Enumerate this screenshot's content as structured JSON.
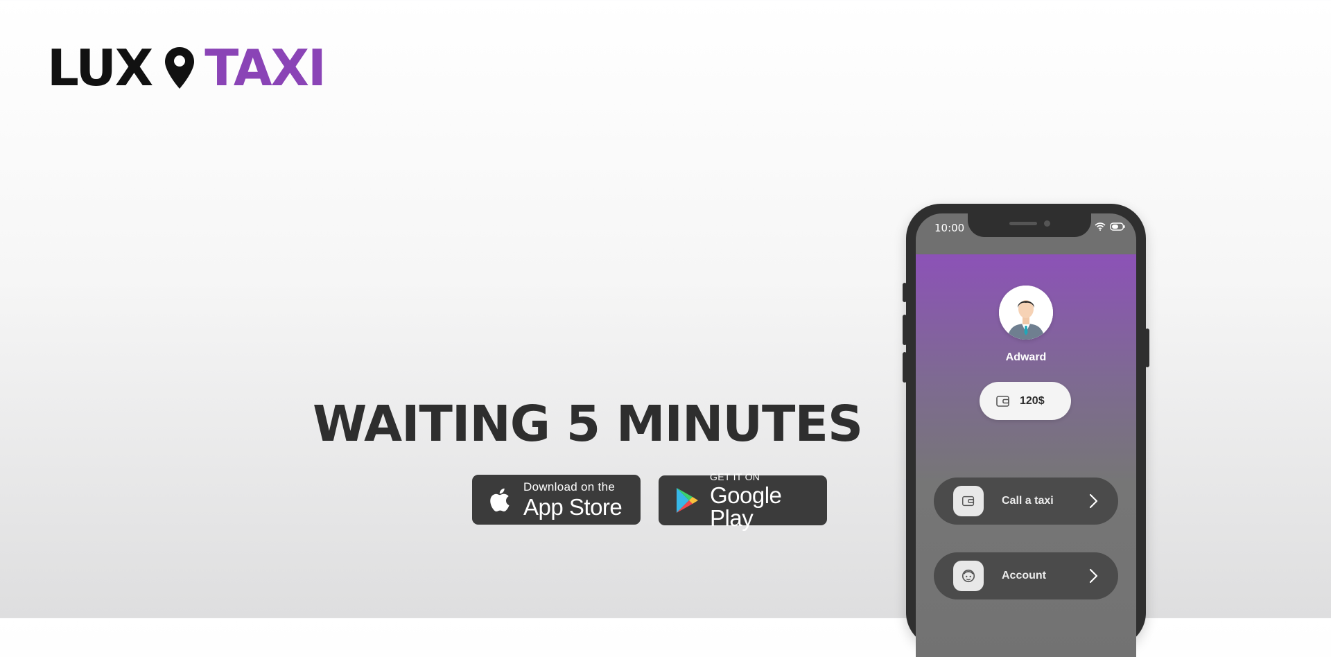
{
  "logo": {
    "part1": "LUX",
    "part2": "TAXI",
    "icon": "location-pin-icon",
    "accent_color": "#8a44b6"
  },
  "headline": "WAITING 5 MINUTES",
  "badges": {
    "appstore": {
      "small": "Download on the",
      "big": "App Store",
      "icon": "apple-icon"
    },
    "googleplay": {
      "small": "GET IT ON",
      "big": "Google Play",
      "icon": "google-play-icon"
    }
  },
  "phone": {
    "status": {
      "time": "10:00",
      "icons": [
        "wifi-icon",
        "battery-icon"
      ]
    },
    "profile": {
      "name": "Adward",
      "avatar": "user-avatar"
    },
    "wallet": {
      "amount": "120$",
      "icon": "wallet-icon"
    },
    "menu": [
      {
        "label": "Call a taxi",
        "icon": "wallet-icon"
      },
      {
        "label": "Account",
        "icon": "face-icon"
      }
    ]
  }
}
